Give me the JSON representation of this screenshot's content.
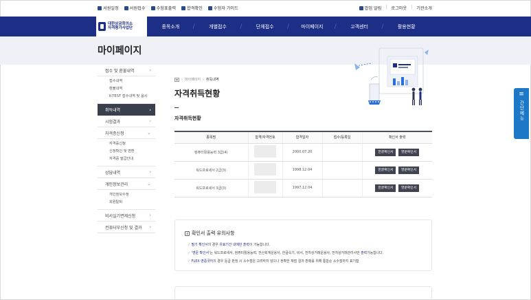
{
  "util_left": [
    {
      "icon": "certificate-icon",
      "label": "서원일정"
    },
    {
      "icon": "register-icon",
      "label": "서원접수"
    },
    {
      "icon": "ticket-icon",
      "label": "수험표출력"
    },
    {
      "icon": "check-icon",
      "label": "합격확인"
    },
    {
      "icon": "guide-icon",
      "label": "수험자 가이드"
    }
  ],
  "util_right": [
    {
      "icon": "popup-icon",
      "label": "팝업 알림"
    },
    {
      "label": "로그아웃"
    },
    {
      "label": "기관소개"
    }
  ],
  "logo": {
    "line1": "대한상공회의소",
    "line2": "자격평가사업단"
  },
  "gnb": [
    "종목소개",
    "개별접수",
    "단체접수",
    "마이페이지",
    "고객센터",
    "활용현황"
  ],
  "page_title": "마이페이지",
  "sidebar": {
    "g1": {
      "label": "접수 및 환불내역",
      "subs": [
        "접수내역",
        "환불내역",
        "K-TEST 접수내역 및 응시"
      ]
    },
    "active": "취득내역",
    "exam": "시험결과",
    "g2": {
      "label": "자격증신청",
      "subs": [
        "자격증신청",
        "신청확인 및 변환",
        "자격증 발급안내"
      ]
    },
    "counsel": "상담내역",
    "g3": {
      "label": "개인정보관리",
      "subs": [
        "개인정보수정",
        "회원탈퇴"
      ]
    },
    "pw": "비서실기면제신청",
    "cert": "컨퓨터부신청 및 결과"
  },
  "breadcrumb": [
    "마이페이지",
    "취득내역"
  ],
  "heading": "자격취득현황",
  "section": "자격취득현황",
  "table": {
    "headers": [
      "종목명",
      "합격/자격번호",
      "합격일자",
      "접수/등록일",
      "확인서 출력"
    ],
    "rows": [
      {
        "name": "컴퓨터활용능력 3급(4)",
        "date": "2000.07.20"
      },
      {
        "name": "워드프로세서 2급(3)",
        "date": "1998.12.04"
      },
      {
        "name": "워드프로세서 3급(3)",
        "date": "1997.12.04"
      }
    ],
    "btn_kr": "한글확인서",
    "btn_en": "영문확인서"
  },
  "notice": {
    "title": "확인서 출력 유의사항",
    "items": [
      {
        "a": "필기 확인서",
        "b": "의 경우 ",
        "c": "유효기간 내에만 출력",
        "d": "이 가능합니다."
      },
      {
        "a": "'영문 확인서'",
        "b": "는 워드프로세서, 컴퓨터활용능력, 전산회계운용사, 한글속기, 비서, 전자상거래운용사, 전자상거래관리사만 ",
        "c": "출력",
        "d": "가능합니다."
      },
      {
        "a": "FLEX 영중국어",
        "b": "의 경우 등급 판정 시 소수점은 고려하지 않으나 정확한 채점 결과 판매를 위해 통합순 소수점까지 표기함",
        "c": "",
        "d": ""
      }
    ]
  },
  "quick_menu": {
    "label": "간단메뉴"
  },
  "colors": {
    "navy": "#1d2e86",
    "band": "#eff1f6",
    "quick": "#1e78c8",
    "dark": "#3f4450"
  }
}
